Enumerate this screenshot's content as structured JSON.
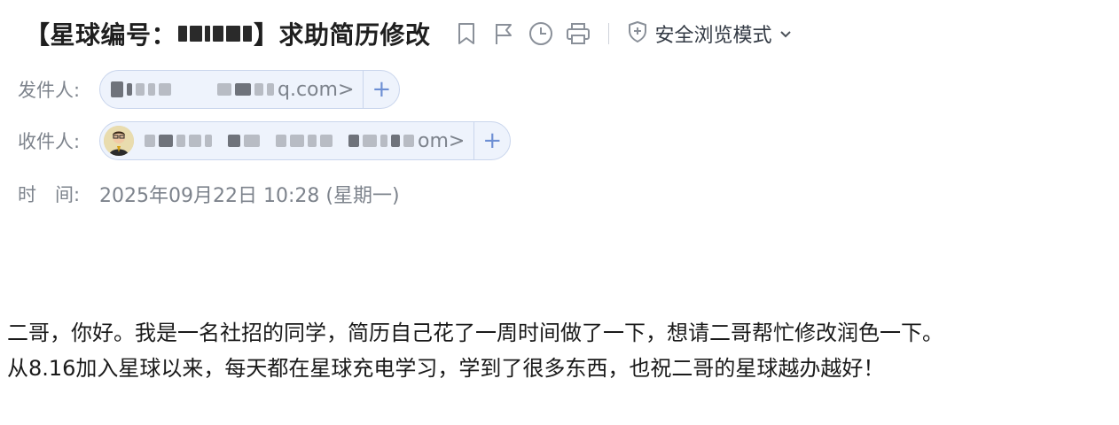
{
  "subject": {
    "prefix": "【星球编号：",
    "suffix": "】求助简历修改"
  },
  "toolbar": {
    "icons": [
      "bookmark-icon",
      "flag-icon",
      "clock-icon",
      "print-icon"
    ],
    "safe_mode_label": "安全浏览模式"
  },
  "sender": {
    "label": "发件人:",
    "visible_tail": "q.com>",
    "add_label": "+"
  },
  "recipient": {
    "label": "收件人:",
    "visible_tail": "om>",
    "add_label": "+"
  },
  "time": {
    "label": "时　间:",
    "value": "2025年09月22日 10:28 (星期一)"
  },
  "body": {
    "line1": "二哥，你好。我是一名社招的同学，简历自己花了一周时间做了一下，想请二哥帮忙修改润色一下。",
    "line2": "从8.16加入星球以来，每天都在星球充电学习，学到了很多东西，也祝二哥的星球越办越好！"
  },
  "colors": {
    "chip_bg": "#eef3fc",
    "chip_border": "#c9d5ec",
    "accent": "#6d8fd4",
    "muted_text": "#7d838c"
  }
}
